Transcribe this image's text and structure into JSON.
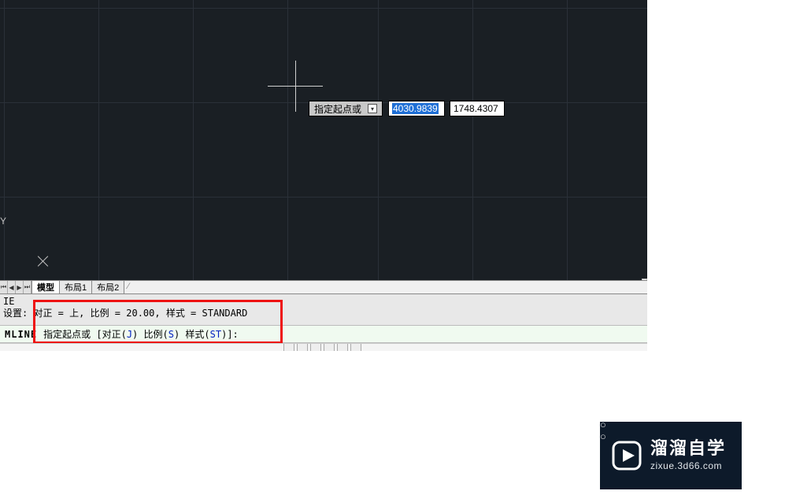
{
  "canvas": {
    "dynamic_input": {
      "label": "指定起点或",
      "x_value": "4030.9839",
      "y_value": "1748.4307"
    },
    "ucs_y_label": "Y"
  },
  "tabs": {
    "model": "模型",
    "layout1": "布局1",
    "layout2": "布局2"
  },
  "command": {
    "history_line1": "IE",
    "history_line2": "设置: 对正 = 上, 比例 = 20.00, 样式 = STANDARD",
    "label": "MLINE",
    "prompt_prefix": "指定起点或 [对正(",
    "opt_j": "J",
    "prompt_mid1": ") 比例(",
    "opt_s": "S",
    "prompt_mid2": ") 样式(",
    "opt_st": "ST",
    "prompt_suffix": ")]:"
  },
  "brand": {
    "faint": "○ ○",
    "zh": "溜溜自学",
    "en": "zixue.3d66.com"
  }
}
